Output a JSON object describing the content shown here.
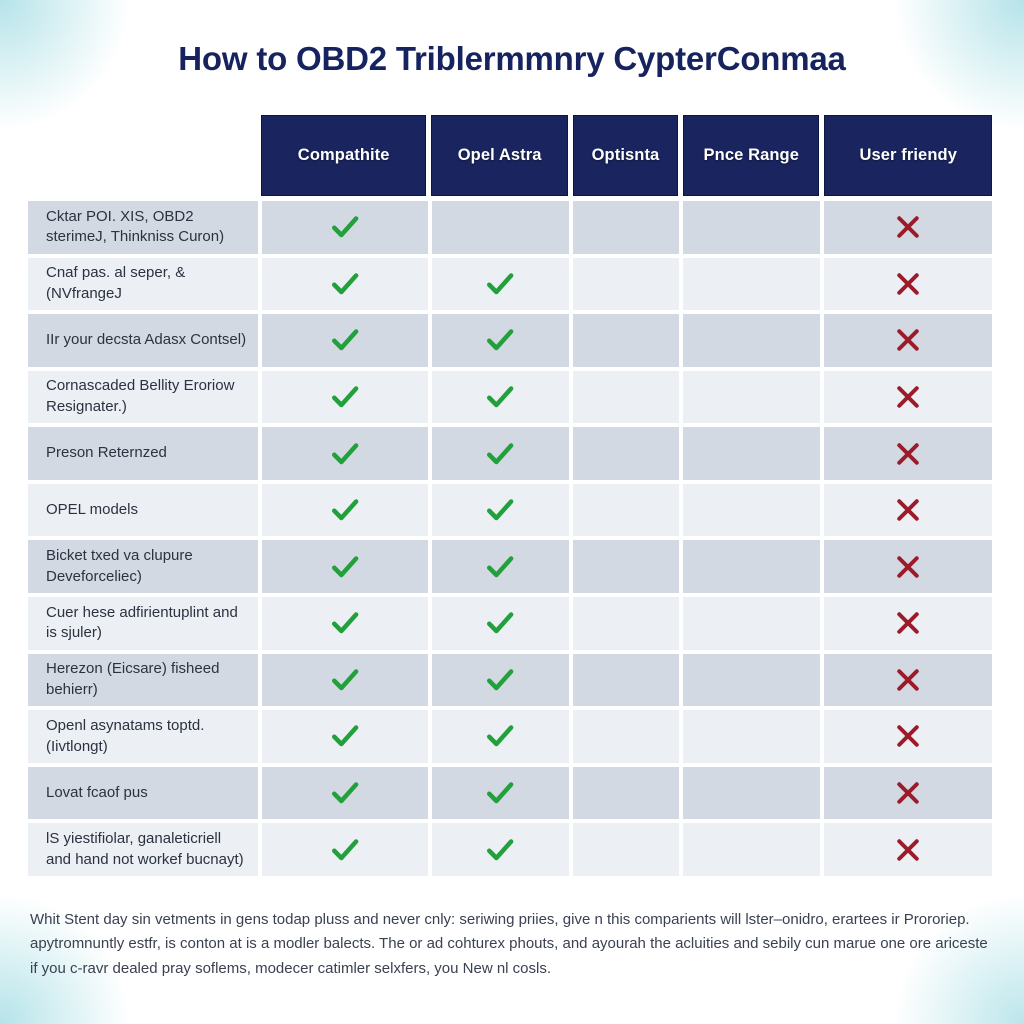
{
  "page": {
    "title": "How to OBD2 Triblermmnry CypterConmaa",
    "title_color": "#17235e",
    "header_bg": "#1a2560",
    "check_color": "#22a03c",
    "cross_color": "#9c1b2a",
    "row_dark_bg": "#d3d9e2",
    "row_light_bg": "#eceff4",
    "page_bg": "#ffffff"
  },
  "table": {
    "columns": [
      {
        "key": "label",
        "label": ""
      },
      {
        "key": "compathite",
        "label": "Compathite"
      },
      {
        "key": "opel_astra",
        "label": "Opel Astra"
      },
      {
        "key": "optisnta",
        "label": "Optisnta"
      },
      {
        "key": "price_range",
        "label": "Pnce Range"
      },
      {
        "key": "user_friendy",
        "label": "User friendy"
      }
    ],
    "rows": [
      {
        "label": "Cktar POI. XIS, OBD2 sterimeJ, Thinkniss Curon)",
        "marks": [
          "check",
          "",
          "",
          "",
          "cross"
        ]
      },
      {
        "label": "Cnaf pas. al seper, & (NVfrangeJ",
        "marks": [
          "check",
          "check",
          "",
          "",
          "cross"
        ]
      },
      {
        "label": "IIr your decsta Adasx Contsel)",
        "marks": [
          "check",
          "check",
          "",
          "",
          "cross"
        ]
      },
      {
        "label": "Cornascaded Bellity Eroriow Resignater.)",
        "marks": [
          "check",
          "check",
          "",
          "",
          "cross"
        ]
      },
      {
        "label": "Preson Reternzed",
        "marks": [
          "check",
          "check",
          "",
          "",
          "cross"
        ]
      },
      {
        "label": "OPEL models",
        "marks": [
          "check",
          "check",
          "",
          "",
          "cross"
        ]
      },
      {
        "label": "Bicket txed va clupure Deveforceliec)",
        "marks": [
          "check",
          "check",
          "",
          "",
          "cross"
        ]
      },
      {
        "label": "Cuer hese adfirientuplint and is sjuler)",
        "marks": [
          "check",
          "check",
          "",
          "",
          "cross"
        ]
      },
      {
        "label": "Herezon (Eicsare) fisheed behierr)",
        "marks": [
          "check",
          "check",
          "",
          "",
          "cross"
        ]
      },
      {
        "label": "Openl asynatams toptd. (Iivtlongt)",
        "marks": [
          "check",
          "check",
          "",
          "",
          "cross"
        ]
      },
      {
        "label": "Lovat fcaof pus",
        "marks": [
          "check",
          "check",
          "",
          "",
          "cross"
        ]
      },
      {
        "label": "lS yiestifiolar, ganaleticriell and hand not workef bucnayt)",
        "marks": [
          "check",
          "check",
          "",
          "",
          "cross"
        ]
      }
    ]
  },
  "footer": {
    "text": "Whit Stent day sin vetments in gens todap pluss and never cnly: seriwing priies, give n this comparients will lster–onidro, erartees ir Prororiep. apytromnuntly estfr, is conton at is a modler balects. The or ad cohturex phouts, and ayourah the acluities and sebily cun marue one ore ariceste if you c-ravr dealed pray soflems, modecer catimler selxfers, you New nl cosls."
  },
  "icons": {
    "check": "check-icon",
    "cross": "cross-icon"
  }
}
